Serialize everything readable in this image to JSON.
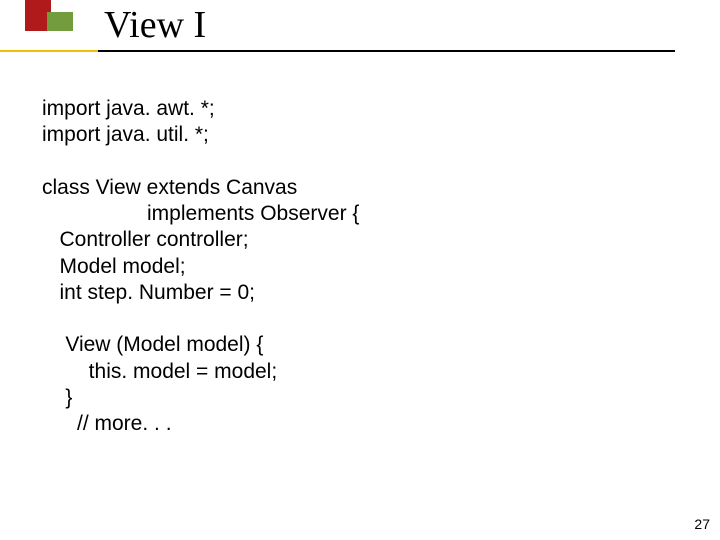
{
  "title": "View I",
  "code": {
    "l1": "import java. awt. *;",
    "l2": "import java. util. *;",
    "l3": "",
    "l4": "class View extends Canvas",
    "l5": "                  implements Observer {",
    "l6": "   Controller controller;",
    "l7": "   Model model;",
    "l8": "   int step. Number = 0;",
    "l9": "",
    "l10": "    View (Model model) {",
    "l11": "        this. model = model;",
    "l12": "    }",
    "l13": "      // more. . ."
  },
  "page_number": "27"
}
